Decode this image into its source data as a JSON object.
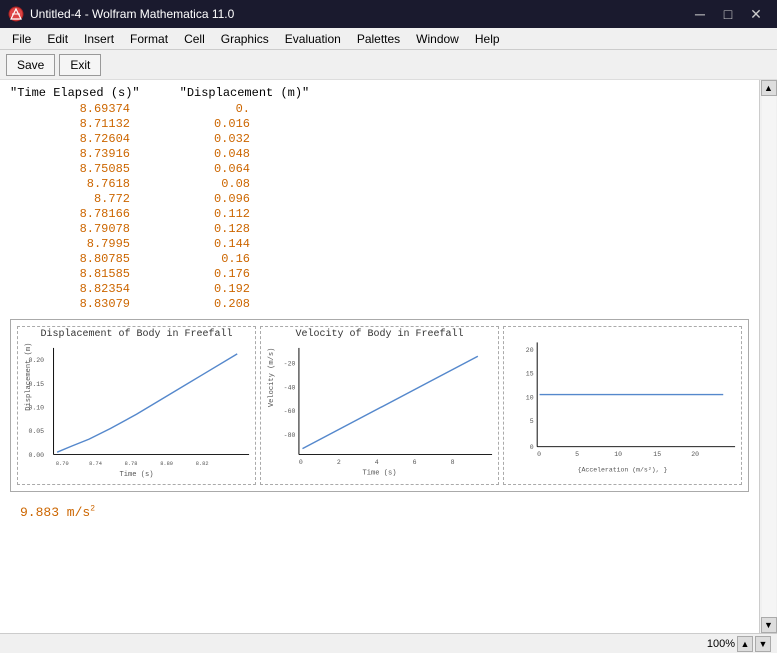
{
  "titleBar": {
    "title": "Untitled-4 - Wolfram Mathematica 11.0",
    "icon": "mathematica-icon",
    "minimizeLabel": "─",
    "maximizeLabel": "□",
    "closeLabel": "✕"
  },
  "menuBar": {
    "items": [
      {
        "label": "File"
      },
      {
        "label": "Edit"
      },
      {
        "label": "Insert"
      },
      {
        "label": "Format"
      },
      {
        "label": "Cell"
      },
      {
        "label": "Graphics"
      },
      {
        "label": "Evaluation"
      },
      {
        "label": "Palettes"
      },
      {
        "label": "Window"
      },
      {
        "label": "Help"
      }
    ]
  },
  "toolbar": {
    "saveLabel": "Save",
    "exitLabel": "Exit"
  },
  "dataTable": {
    "headers": [
      "\"Time Elapsed (s)\"",
      "\"Displacement (m)\""
    ],
    "rows": [
      {
        "time": "8.69374",
        "disp": "0."
      },
      {
        "time": "8.71132",
        "disp": "0.016"
      },
      {
        "time": "8.72604",
        "disp": "0.032"
      },
      {
        "time": "8.73916",
        "disp": "0.048"
      },
      {
        "time": "8.75085",
        "disp": "0.064"
      },
      {
        "time": "8.7618",
        "disp": "0.08"
      },
      {
        "time": "8.772",
        "disp": "0.096"
      },
      {
        "time": "8.78166",
        "disp": "0.112"
      },
      {
        "time": "8.79078",
        "disp": "0.128"
      },
      {
        "time": "8.7995",
        "disp": "0.144"
      },
      {
        "time": "8.80785",
        "disp": "0.16"
      },
      {
        "time": "8.81585",
        "disp": "0.176"
      },
      {
        "time": "8.82354",
        "disp": "0.192"
      },
      {
        "time": "8.83079",
        "disp": "0.208"
      }
    ]
  },
  "charts": [
    {
      "title": "Displacement of Body in Freefall",
      "xLabel": "Time (s)",
      "yLabel": "Displacement (m)",
      "xRange": "8.708.728.748.768.788.80 8.82",
      "yRange": "0.00 0.05 0.10 0.15 0.20"
    },
    {
      "title": "Velocity of Body in Freefall",
      "xLabel": "Time (s)",
      "yLabel": "Velocity (m/s)",
      "xRange": "0 2 4 6 8",
      "yRange": "-20 -40 -60 -80"
    },
    {
      "title": "",
      "xLabel": "{Acceleration (m/s²), }",
      "yLabel": "",
      "xRange": "0 5 10 15 20",
      "yRange": "0 5 10 15 20"
    }
  ],
  "result": {
    "value": "9.883",
    "unit": "m/s²"
  },
  "statusBar": {
    "zoom": "100%",
    "upArrow": "▲",
    "downArrow": "▼"
  }
}
